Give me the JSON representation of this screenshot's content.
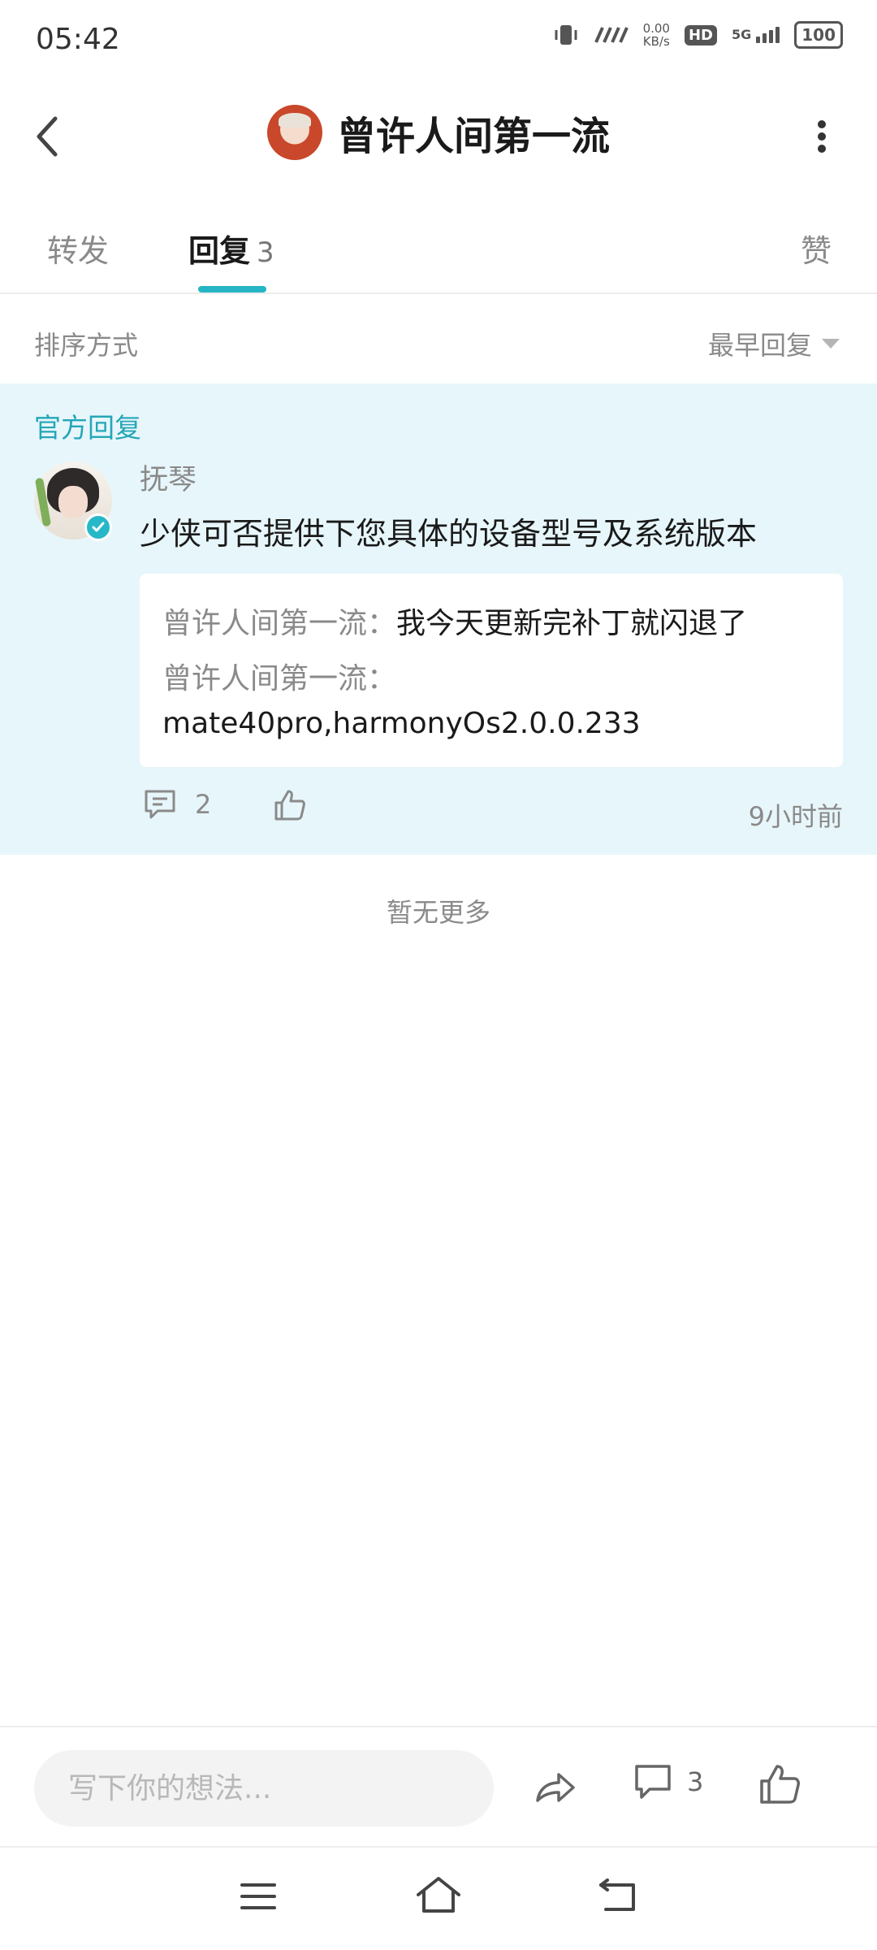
{
  "status_bar": {
    "time": "05:42",
    "net_speed_value": "0.00",
    "net_speed_unit": "KB/s",
    "hd_badge": "HD",
    "network": "5G",
    "battery": "100"
  },
  "header": {
    "title": "曾许人间第一流",
    "back_icon": "chevron-left-icon",
    "more_icon": "more-vertical-icon"
  },
  "tabs": {
    "forward": "转发",
    "reply": "回复",
    "reply_count": "3",
    "like": "赞"
  },
  "sort": {
    "label": "排序方式",
    "value": "最早回复"
  },
  "official_reply": {
    "label": "官方回复",
    "author": "抚琴",
    "content": "少侠可否提供下您具体的设备型号及系统版本",
    "quotes": {
      "name1": "曾许人间第一流",
      "text1": "我今天更新完补丁就闪退了",
      "name2": "曾许人间第一流",
      "text2": "mate40pro,harmonyOs2.0.0.233"
    },
    "comment_count": "2",
    "time": "9小时前"
  },
  "no_more": "暂无更多",
  "bottom_bar": {
    "input_placeholder": "写下你的想法...",
    "comment_count": "3"
  },
  "colors": {
    "accent": "#25b5c4",
    "official_bg": "#e7f6fa",
    "official_text": "#24a6b8"
  }
}
